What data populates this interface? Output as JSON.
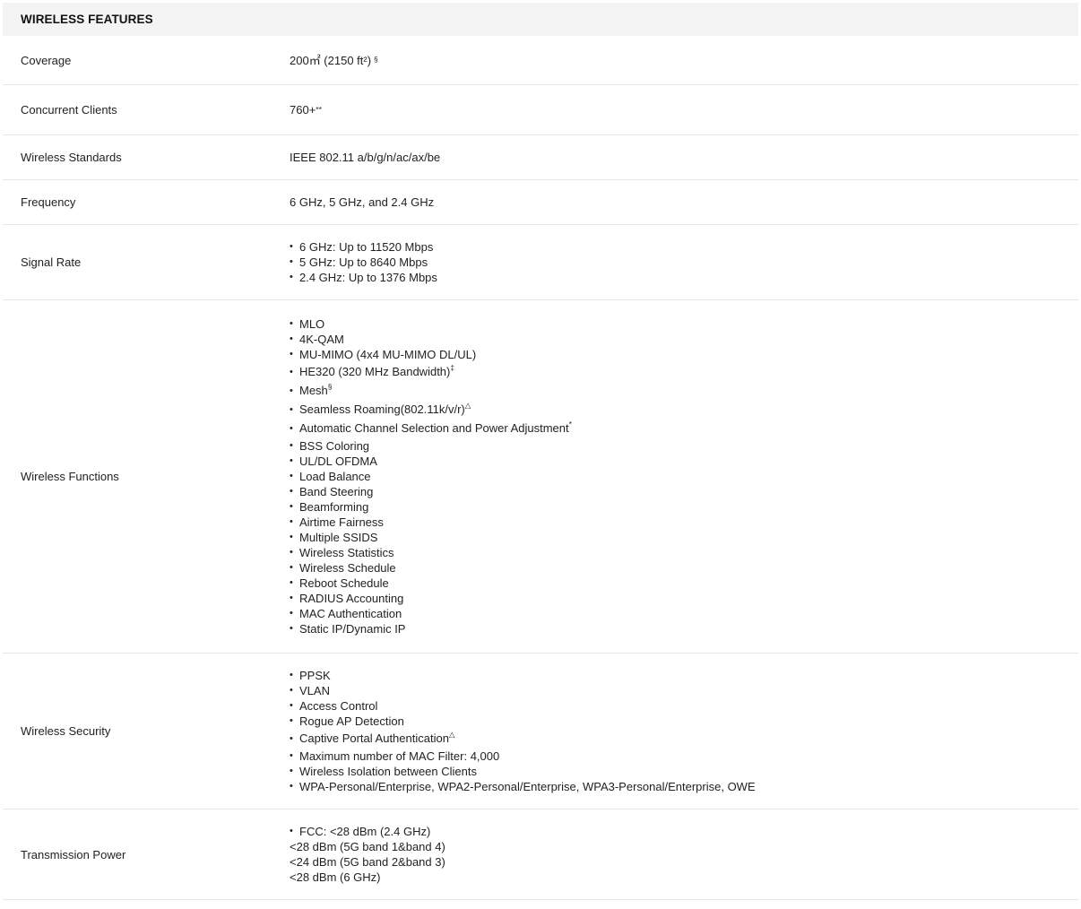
{
  "section_title": "WIRELESS FEATURES",
  "rows": {
    "coverage": {
      "label": "Coverage",
      "value": "200㎡ (2150 ft²)",
      "sup": "§"
    },
    "clients": {
      "label": "Concurrent Clients",
      "value": "760+",
      "sup": "**"
    },
    "standards": {
      "label": "Wireless Standards",
      "value": "IEEE 802.11 a/b/g/n/ac/ax/be"
    },
    "frequency": {
      "label": "Frequency",
      "value": "6 GHz, 5 GHz, and 2.4 GHz"
    },
    "signal_rate": {
      "label": "Signal Rate",
      "items": [
        "6 GHz: Up to 11520 Mbps",
        "5 GHz: Up to 8640 Mbps",
        "2.4 GHz: Up to 1376 Mbps"
      ]
    },
    "functions": {
      "label": "Wireless Functions",
      "items": [
        "MLO",
        "4K-QAM",
        "MU-MIMO (4x4 MU-MIMO DL/UL)",
        "HE320 (320 MHz Bandwidth)",
        "Mesh",
        "Seamless Roaming(802.11k/v/r)",
        "Automatic Channel Selection and Power Adjustment",
        "BSS Coloring",
        "UL/DL OFDMA",
        "Load Balance",
        "Band Steering",
        "Beamforming",
        "Airtime Fairness",
        "Multiple SSIDS",
        "Wireless Statistics",
        "Wireless Schedule",
        "Reboot Schedule",
        "RADIUS Accounting",
        "MAC Authentication",
        "Static IP/Dynamic IP"
      ],
      "sups": {
        "he320": "‡",
        "mesh": "§",
        "roaming": "△",
        "auto_channel": "*"
      }
    },
    "security": {
      "label": "Wireless Security",
      "items": [
        "PPSK",
        "VLAN",
        "Access Control",
        "Rogue AP Detection",
        "Captive Portal Authentication",
        "Maximum number of MAC Filter: 4,000",
        "Wireless Isolation between Clients",
        "WPA-Personal/Enterprise, WPA2-Personal/Enterprise, WPA3-Personal/Enterprise, OWE"
      ],
      "sups": {
        "captive": "△"
      }
    },
    "tx_power": {
      "label": "Transmission Power",
      "items": [
        "FCC: <28 dBm (2.4 GHz)",
        "<28 dBm (5G band 1&band 4)",
        "<24 dBm (5G band 2&band 3)",
        "<28 dBm (6 GHz)"
      ]
    }
  }
}
